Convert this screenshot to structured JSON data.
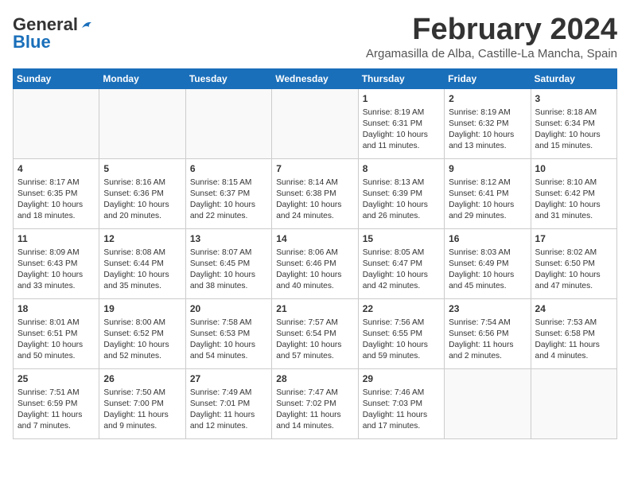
{
  "header": {
    "logo_general": "General",
    "logo_blue": "Blue",
    "month_title": "February 2024",
    "subtitle": "Argamasilla de Alba, Castille-La Mancha, Spain"
  },
  "weekdays": [
    "Sunday",
    "Monday",
    "Tuesday",
    "Wednesday",
    "Thursday",
    "Friday",
    "Saturday"
  ],
  "weeks": [
    [
      {
        "day": "",
        "info": ""
      },
      {
        "day": "",
        "info": ""
      },
      {
        "day": "",
        "info": ""
      },
      {
        "day": "",
        "info": ""
      },
      {
        "day": "1",
        "info": "Sunrise: 8:19 AM\nSunset: 6:31 PM\nDaylight: 10 hours\nand 11 minutes."
      },
      {
        "day": "2",
        "info": "Sunrise: 8:19 AM\nSunset: 6:32 PM\nDaylight: 10 hours\nand 13 minutes."
      },
      {
        "day": "3",
        "info": "Sunrise: 8:18 AM\nSunset: 6:34 PM\nDaylight: 10 hours\nand 15 minutes."
      }
    ],
    [
      {
        "day": "4",
        "info": "Sunrise: 8:17 AM\nSunset: 6:35 PM\nDaylight: 10 hours\nand 18 minutes."
      },
      {
        "day": "5",
        "info": "Sunrise: 8:16 AM\nSunset: 6:36 PM\nDaylight: 10 hours\nand 20 minutes."
      },
      {
        "day": "6",
        "info": "Sunrise: 8:15 AM\nSunset: 6:37 PM\nDaylight: 10 hours\nand 22 minutes."
      },
      {
        "day": "7",
        "info": "Sunrise: 8:14 AM\nSunset: 6:38 PM\nDaylight: 10 hours\nand 24 minutes."
      },
      {
        "day": "8",
        "info": "Sunrise: 8:13 AM\nSunset: 6:39 PM\nDaylight: 10 hours\nand 26 minutes."
      },
      {
        "day": "9",
        "info": "Sunrise: 8:12 AM\nSunset: 6:41 PM\nDaylight: 10 hours\nand 29 minutes."
      },
      {
        "day": "10",
        "info": "Sunrise: 8:10 AM\nSunset: 6:42 PM\nDaylight: 10 hours\nand 31 minutes."
      }
    ],
    [
      {
        "day": "11",
        "info": "Sunrise: 8:09 AM\nSunset: 6:43 PM\nDaylight: 10 hours\nand 33 minutes."
      },
      {
        "day": "12",
        "info": "Sunrise: 8:08 AM\nSunset: 6:44 PM\nDaylight: 10 hours\nand 35 minutes."
      },
      {
        "day": "13",
        "info": "Sunrise: 8:07 AM\nSunset: 6:45 PM\nDaylight: 10 hours\nand 38 minutes."
      },
      {
        "day": "14",
        "info": "Sunrise: 8:06 AM\nSunset: 6:46 PM\nDaylight: 10 hours\nand 40 minutes."
      },
      {
        "day": "15",
        "info": "Sunrise: 8:05 AM\nSunset: 6:47 PM\nDaylight: 10 hours\nand 42 minutes."
      },
      {
        "day": "16",
        "info": "Sunrise: 8:03 AM\nSunset: 6:49 PM\nDaylight: 10 hours\nand 45 minutes."
      },
      {
        "day": "17",
        "info": "Sunrise: 8:02 AM\nSunset: 6:50 PM\nDaylight: 10 hours\nand 47 minutes."
      }
    ],
    [
      {
        "day": "18",
        "info": "Sunrise: 8:01 AM\nSunset: 6:51 PM\nDaylight: 10 hours\nand 50 minutes."
      },
      {
        "day": "19",
        "info": "Sunrise: 8:00 AM\nSunset: 6:52 PM\nDaylight: 10 hours\nand 52 minutes."
      },
      {
        "day": "20",
        "info": "Sunrise: 7:58 AM\nSunset: 6:53 PM\nDaylight: 10 hours\nand 54 minutes."
      },
      {
        "day": "21",
        "info": "Sunrise: 7:57 AM\nSunset: 6:54 PM\nDaylight: 10 hours\nand 57 minutes."
      },
      {
        "day": "22",
        "info": "Sunrise: 7:56 AM\nSunset: 6:55 PM\nDaylight: 10 hours\nand 59 minutes."
      },
      {
        "day": "23",
        "info": "Sunrise: 7:54 AM\nSunset: 6:56 PM\nDaylight: 11 hours\nand 2 minutes."
      },
      {
        "day": "24",
        "info": "Sunrise: 7:53 AM\nSunset: 6:58 PM\nDaylight: 11 hours\nand 4 minutes."
      }
    ],
    [
      {
        "day": "25",
        "info": "Sunrise: 7:51 AM\nSunset: 6:59 PM\nDaylight: 11 hours\nand 7 minutes."
      },
      {
        "day": "26",
        "info": "Sunrise: 7:50 AM\nSunset: 7:00 PM\nDaylight: 11 hours\nand 9 minutes."
      },
      {
        "day": "27",
        "info": "Sunrise: 7:49 AM\nSunset: 7:01 PM\nDaylight: 11 hours\nand 12 minutes."
      },
      {
        "day": "28",
        "info": "Sunrise: 7:47 AM\nSunset: 7:02 PM\nDaylight: 11 hours\nand 14 minutes."
      },
      {
        "day": "29",
        "info": "Sunrise: 7:46 AM\nSunset: 7:03 PM\nDaylight: 11 hours\nand 17 minutes."
      },
      {
        "day": "",
        "info": ""
      },
      {
        "day": "",
        "info": ""
      }
    ]
  ]
}
